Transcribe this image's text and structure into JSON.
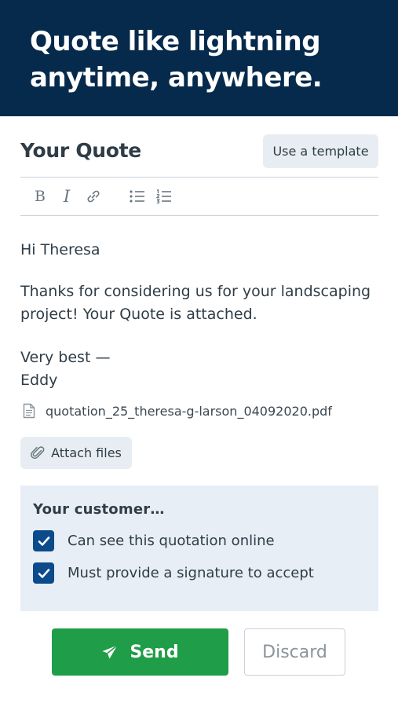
{
  "hero": {
    "line1": "Quote like lightning",
    "line2": "anytime, anywhere."
  },
  "header": {
    "title": "Your Quote",
    "template_button": "Use a template"
  },
  "toolbar": {
    "bold_glyph": "B",
    "italic_glyph": "I",
    "icons": [
      "bold-icon",
      "italic-icon",
      "link-icon",
      "bulleted-list-icon",
      "numbered-list-icon"
    ]
  },
  "message": {
    "greeting": "Hi Theresa",
    "body": "Thanks for considering us for your landscaping project! Your Quote is attached.",
    "signoff": "Very best —",
    "name": "Eddy"
  },
  "attachment": {
    "filename": "quotation_25_theresa-g-larson_04092020.pdf",
    "icon": "document-icon"
  },
  "attach_button": {
    "label": "Attach files",
    "icon": "paperclip-icon"
  },
  "customer": {
    "title": "Your customer…",
    "options": [
      {
        "label": "Can see this quotation online",
        "checked": true
      },
      {
        "label": "Must provide a signature to accept",
        "checked": true
      }
    ]
  },
  "actions": {
    "send": "Send",
    "send_icon": "paper-plane-icon",
    "discard": "Discard"
  },
  "colors": {
    "hero_bg": "#062a4c",
    "send_green": "#1f9d48",
    "checkbox_blue": "#0b4a8b",
    "panel_bg": "#e8eef6"
  }
}
